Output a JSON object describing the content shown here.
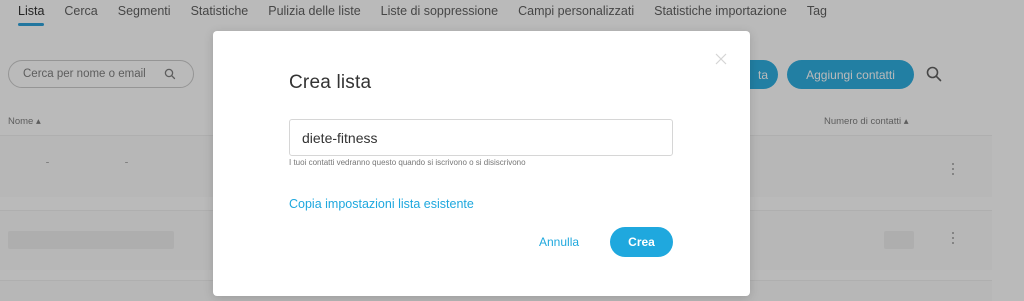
{
  "tabs": [
    {
      "label": "Lista",
      "active": true
    },
    {
      "label": "Cerca"
    },
    {
      "label": "Segmenti"
    },
    {
      "label": "Statistiche"
    },
    {
      "label": "Pulizia delle liste"
    },
    {
      "label": "Liste di soppressione"
    },
    {
      "label": "Campi personalizzati"
    },
    {
      "label": "Statistiche importazione"
    },
    {
      "label": "Tag"
    }
  ],
  "toolbar": {
    "search_placeholder": "Cerca per nome o email",
    "partial_button_label": "ta",
    "add_contacts_label": "Aggiungi contatti"
  },
  "table": {
    "col_name": "Nome",
    "col_count": "Numero di contatti"
  },
  "modal": {
    "title": "Crea lista",
    "input_value": "diete-fitness",
    "helper_text": "I tuoi contatti vedranno questo quando si iscrivono o si disiscrivono",
    "copy_link": "Copia impostazioni lista esistente",
    "cancel_label": "Annulla",
    "create_label": "Crea"
  },
  "colors": {
    "accent": "#1fa8de",
    "tab_underline": "#1f9bd7",
    "overlay": "rgba(40,40,40,0.32)"
  }
}
